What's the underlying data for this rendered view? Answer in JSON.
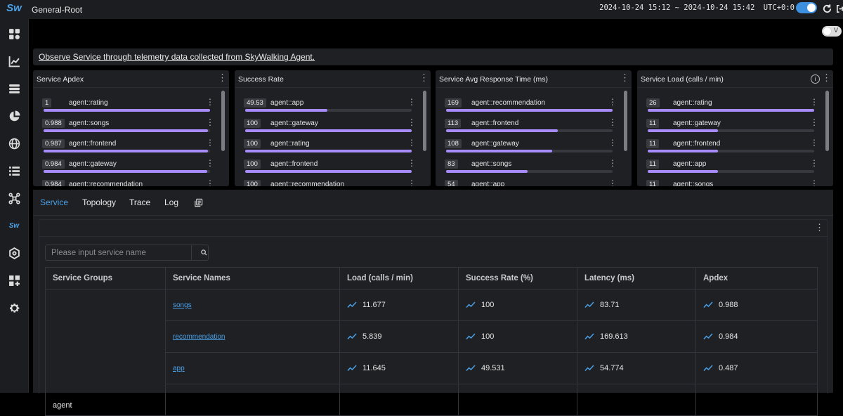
{
  "app": {
    "logo_text": "Sw",
    "title": "General-Root"
  },
  "topbar": {
    "time_range": "2024-10-24 15:12 ~ 2024-10-24 15:42",
    "timezone": "UTC+0:0",
    "theme_toggle_on": true
  },
  "sidebar": {
    "items": [
      {
        "icon": "dashboard-icon"
      },
      {
        "icon": "chart-icon"
      },
      {
        "icon": "database-icon"
      },
      {
        "icon": "pie-chart-icon"
      },
      {
        "icon": "globe-icon"
      },
      {
        "icon": "list-icon"
      },
      {
        "icon": "topology-icon"
      },
      {
        "icon": "skywalking-icon",
        "text": "Sw"
      },
      {
        "icon": "hexagon-icon"
      },
      {
        "icon": "add-widget-icon"
      },
      {
        "icon": "settings-icon"
      }
    ]
  },
  "view_toggle": {
    "label": "V"
  },
  "description": "Observe Service through telemetry data collected from SkyWalking Agent.",
  "panels": [
    {
      "title": "Service Apdex",
      "info": false,
      "rows": [
        {
          "value": "1",
          "name": "agent::rating",
          "fraction": 1.0
        },
        {
          "value": "0.988",
          "name": "agent::songs",
          "fraction": 0.988
        },
        {
          "value": "0.987",
          "name": "agent::frontend",
          "fraction": 0.987
        },
        {
          "value": "0.984",
          "name": "agent::gateway",
          "fraction": 0.984
        },
        {
          "value": "0.984",
          "name": "agent::recommendation",
          "fraction": 0.984
        }
      ]
    },
    {
      "title": "Success Rate",
      "info": false,
      "rows": [
        {
          "value": "49.53",
          "name": "agent::app",
          "fraction": 0.4953
        },
        {
          "value": "100",
          "name": "agent::gateway",
          "fraction": 1.0
        },
        {
          "value": "100",
          "name": "agent::rating",
          "fraction": 1.0
        },
        {
          "value": "100",
          "name": "agent::frontend",
          "fraction": 1.0
        },
        {
          "value": "100",
          "name": "agent::recommendation",
          "fraction": 1.0
        }
      ]
    },
    {
      "title": "Service Avg Response Time (ms)",
      "info": false,
      "rows": [
        {
          "value": "169",
          "name": "agent::recommendation",
          "fraction": 1.0
        },
        {
          "value": "113",
          "name": "agent::frontend",
          "fraction": 0.669
        },
        {
          "value": "108",
          "name": "agent::gateway",
          "fraction": 0.639
        },
        {
          "value": "83",
          "name": "agent::songs",
          "fraction": 0.491
        },
        {
          "value": "54",
          "name": "agent::app",
          "fraction": 0.32
        }
      ]
    },
    {
      "title": "Service Load (calls / min)",
      "info": true,
      "rows": [
        {
          "value": "26",
          "name": "agent::rating",
          "fraction": 1.0
        },
        {
          "value": "11",
          "name": "agent::gateway",
          "fraction": 0.423
        },
        {
          "value": "11",
          "name": "agent::frontend",
          "fraction": 0.423
        },
        {
          "value": "11",
          "name": "agent::app",
          "fraction": 0.423
        },
        {
          "value": "11",
          "name": "agent::songs",
          "fraction": 0.423
        }
      ]
    }
  ],
  "tabs": [
    "Service",
    "Topology",
    "Trace",
    "Log"
  ],
  "active_tab": "Service",
  "search": {
    "placeholder": "Please input service name",
    "value": ""
  },
  "table": {
    "headers": [
      "Service Groups",
      "Service Names",
      "Load (calls / min)",
      "Success Rate (%)",
      "Latency (ms)",
      "Apdex"
    ],
    "group": "agent",
    "rows": [
      {
        "name": "songs",
        "load": "11.677",
        "success": "100",
        "latency": "83.71",
        "apdex": "0.988"
      },
      {
        "name": "recommendation",
        "load": "5.839",
        "success": "100",
        "latency": "169.613",
        "apdex": "0.984"
      },
      {
        "name": "app",
        "load": "11.645",
        "success": "49.531",
        "latency": "54.774",
        "apdex": "0.487"
      }
    ]
  },
  "colors": {
    "accent": "#4aa0e6",
    "bar": "#a78bfa",
    "background": "#000000",
    "panel": "#1f2024"
  }
}
